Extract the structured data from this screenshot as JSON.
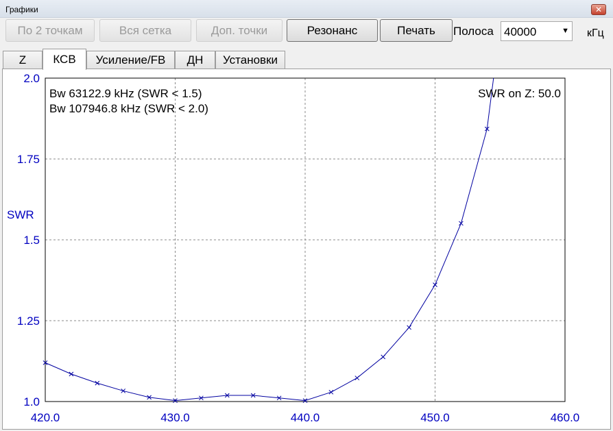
{
  "window": {
    "title": "Графики",
    "close_glyph": "✕"
  },
  "toolbar": {
    "by_two_points": "По 2 точкам",
    "whole_grid": "Вся сетка",
    "extra_points": "Доп. точки",
    "resonance": "Резонанс",
    "print": "Печать",
    "band_label": "Полоса",
    "band_value": "40000",
    "band_unit": "кГц"
  },
  "tabs": [
    {
      "label": "Z"
    },
    {
      "label": "КСВ"
    },
    {
      "label": "Усиление/FB"
    },
    {
      "label": "ДН"
    },
    {
      "label": "Установки"
    }
  ],
  "chart_data": {
    "type": "line",
    "ylabel": "SWR",
    "xlim": [
      420.0,
      460.0
    ],
    "ylim": [
      1.0,
      2.0
    ],
    "xticks": [
      "420.0",
      "430.0",
      "440.0",
      "450.0",
      "460.0"
    ],
    "yticks": [
      "1.0",
      "1.25",
      "1.5",
      "1.75",
      "2.0"
    ],
    "grid": true,
    "annotations": [
      "Bw 63122.9 kHz (SWR < 1.5)",
      "Bw 107946.8 kHz (SWR < 2.0)",
      "SWR on Z: 50.0"
    ],
    "series": [
      {
        "color": "#0000a0",
        "marker": "x",
        "x": [
          420,
          422,
          424,
          426,
          428,
          430,
          432,
          434,
          436,
          438,
          440,
          442,
          444,
          446,
          448,
          450,
          452,
          454,
          454.5
        ],
        "y": [
          1.12,
          1.085,
          1.057,
          1.033,
          1.013,
          1.003,
          1.011,
          1.019,
          1.019,
          1.011,
          1.003,
          1.029,
          1.073,
          1.138,
          1.229,
          1.361,
          1.551,
          1.843,
          2.0
        ]
      }
    ]
  }
}
